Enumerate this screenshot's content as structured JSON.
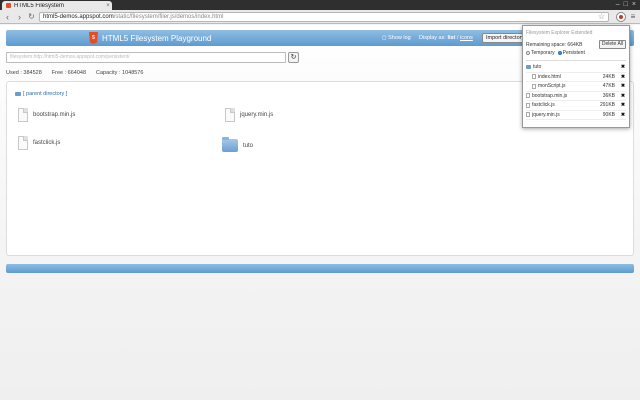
{
  "browser": {
    "tab_title": "HTML5 Filesystem",
    "tab_close": "×",
    "url_host": "html5-demos.appspot.com",
    "url_path": "/static/filesystem/filer.js/demos/index.html",
    "back": "‹",
    "forward": "›",
    "reload": "↻",
    "star": "☆",
    "menu": "≡",
    "window_buttons": [
      "–",
      "□",
      "×"
    ]
  },
  "header": {
    "title": "HTML5 Filesystem Playground",
    "badge": "5",
    "show_log": "Show log",
    "display_as": "Display as:",
    "display_list": "list",
    "display_sep": "/",
    "display_icons": "icons",
    "import_button": "Import directory"
  },
  "path_input": {
    "value": "filesystem:http://html5-demos.appspot.com/persistent/",
    "refresh": "↻"
  },
  "stats": {
    "used": "Used : 384528",
    "free": "Free : 664048",
    "capacity": "Capacity : 1048576"
  },
  "browser_panel": {
    "parent_dir": "[ parent directory ]",
    "entries": [
      {
        "name": "bootstrap.min.js",
        "type": "file"
      },
      {
        "name": "jquery.min.js",
        "type": "file"
      },
      {
        "name": "fastclick.js",
        "type": "file"
      },
      {
        "name": "tuto",
        "type": "folder"
      }
    ]
  },
  "popup": {
    "title": "Filesystem Explorer Extended",
    "remaining": "Remaining space: 664KB",
    "delete_all": "Delete All",
    "temporary": "Temporary",
    "persistent": "Persistent",
    "del": "✖",
    "tree": [
      {
        "name": "tuto",
        "size": "",
        "type": "dir",
        "indent": false
      },
      {
        "name": "index.html",
        "size": "24KB",
        "type": "file",
        "indent": true
      },
      {
        "name": "monScript.js",
        "size": "47KB",
        "type": "file",
        "indent": true
      },
      {
        "name": "bootstrap.min.js",
        "size": "36KB",
        "type": "file",
        "indent": false
      },
      {
        "name": "fastclick.js",
        "size": "291KB",
        "type": "file",
        "indent": false
      },
      {
        "name": "jquery.min.js",
        "size": "90KB",
        "type": "file",
        "indent": false
      }
    ]
  },
  "colors": {
    "navbar": "#5e9bd0",
    "html5": "#e44d26",
    "link": "#2a6db0"
  }
}
